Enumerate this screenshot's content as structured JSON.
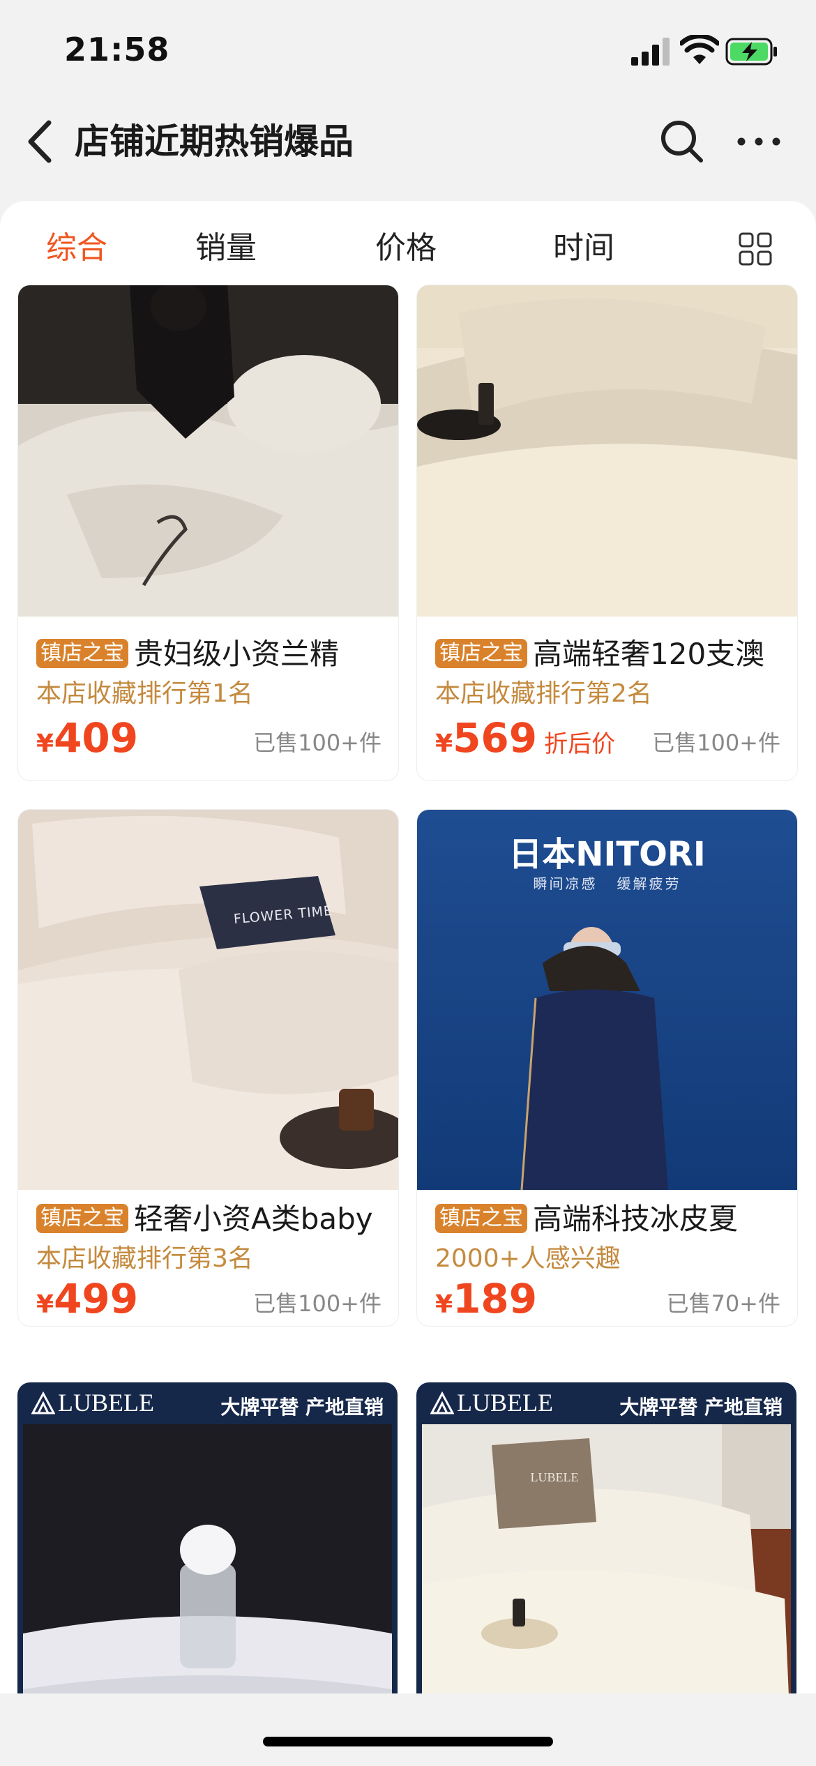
{
  "status": {
    "time": "21:58"
  },
  "nav": {
    "title": "店铺近期热销爆品"
  },
  "sort_tabs": [
    {
      "label": "综合",
      "active": true
    },
    {
      "label": "销量",
      "active": false
    },
    {
      "label": "价格",
      "active": false
    },
    {
      "label": "时间",
      "active": false
    }
  ],
  "products": [
    {
      "badge": "镇店之宝",
      "title": "贵妇级小资兰精",
      "sub": "本店收藏排行第1名",
      "currency": "¥",
      "price": "409",
      "price_note": "",
      "sold": "已售100+件"
    },
    {
      "badge": "镇店之宝",
      "title": "高端轻奢120支澳",
      "sub": "本店收藏排行第2名",
      "currency": "¥",
      "price": "569",
      "price_note": "折后价",
      "sold": "已售100+件"
    },
    {
      "badge": "镇店之宝",
      "title": "轻奢小资A类baby",
      "sub": "本店收藏排行第3名",
      "currency": "¥",
      "price": "499",
      "price_note": "",
      "sold": "已售100+件"
    },
    {
      "badge": "镇店之宝",
      "title": "高端科技冰皮夏",
      "sub": "2000+人感兴趣",
      "currency": "¥",
      "price": "189",
      "price_note": "",
      "sold": "已售70+件"
    }
  ],
  "image_text": {
    "pillow_label": "FLOWER TIME",
    "nitori_title": "日本NITORI",
    "nitori_sub": "瞬间凉感   缓解疲劳",
    "lubele_brand": "LUBELE",
    "lubele_slogan": "大牌平替 产地直销",
    "lubele_pillow": "LUBELE"
  },
  "colors": {
    "accent": "#f0461f",
    "badge": "#d9822b",
    "subtitle": "#c48a3e"
  }
}
